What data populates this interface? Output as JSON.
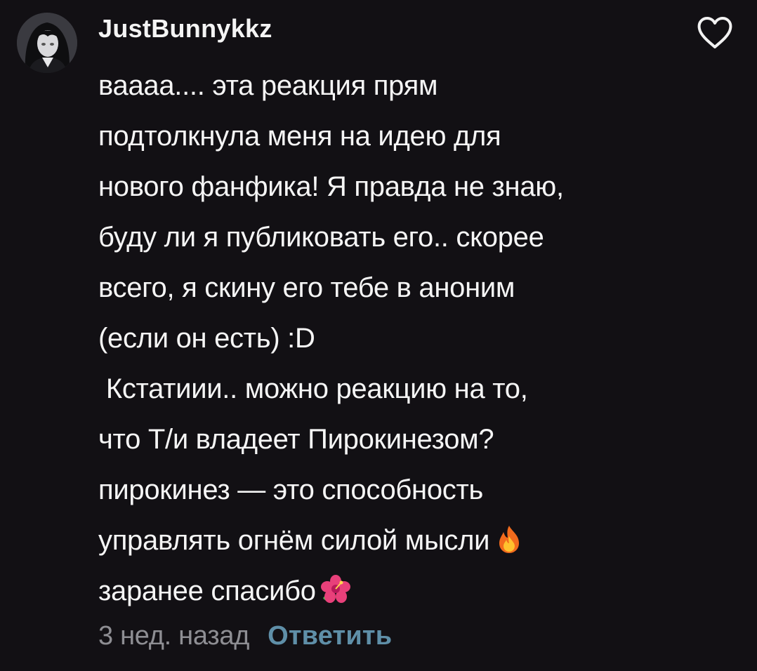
{
  "comment": {
    "author": "JustBunnykkz",
    "lines": [
      "ваааа.... эта реакция прям",
      "подтолкнула меня на идею для",
      "нового фанфика! Я правда не знаю,",
      "буду ли я публиковать его.. скорее",
      "всего, я скину его тебе в аноним",
      "(если он есть) :D",
      " Кстатиии.. можно реакцию на то,",
      "что Т/и владеет Пирокинезом?",
      "пирокинез — это способность",
      "управлять огнём силой мысли",
      "заранее спасибо"
    ],
    "emojis": {
      "line_10": "fire-icon",
      "line_11": "hibiscus-icon"
    },
    "timestamp": "3 нед. назад",
    "reply_label": "Ответить",
    "like_icon": "heart-outline-icon"
  },
  "colors": {
    "background": "#121014",
    "text": "#f5f5f5",
    "timestamp": "#8e8e93",
    "reply": "#5f8fa8"
  }
}
